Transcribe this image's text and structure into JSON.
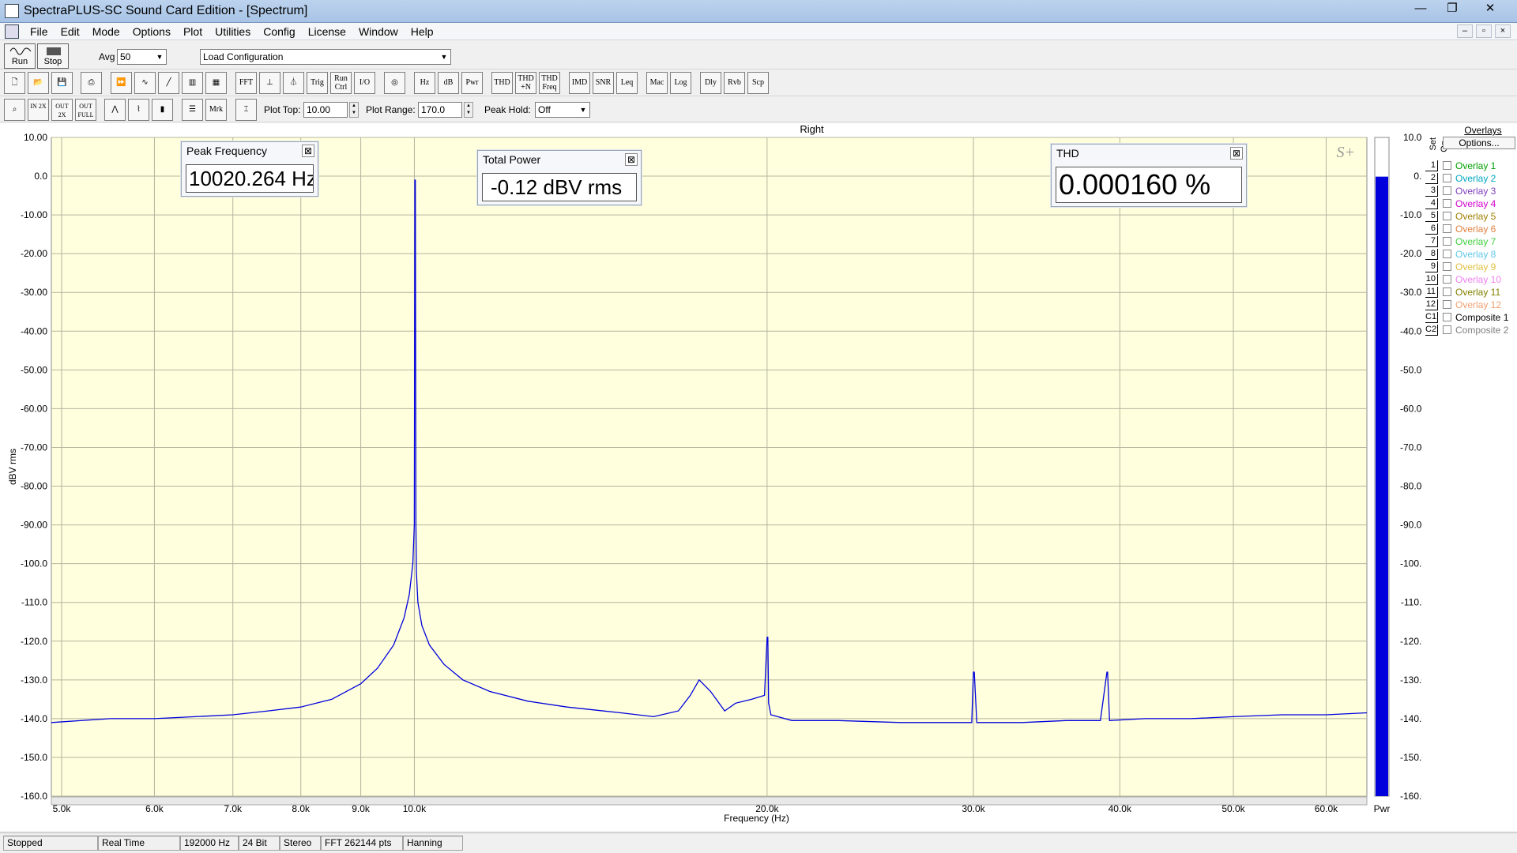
{
  "window": {
    "title": "SpectraPLUS-SC Sound Card Edition - [Spectrum]",
    "buttons": [
      "—",
      "❐",
      "✕"
    ]
  },
  "menu": [
    "File",
    "Edit",
    "Mode",
    "Options",
    "Plot",
    "Utilities",
    "Config",
    "License",
    "Window",
    "Help"
  ],
  "mdi_buttons": [
    "–",
    "▫",
    "×"
  ],
  "toolbar1": {
    "run": "Run",
    "stop": "Stop",
    "avg_label": "Avg",
    "avg_value": "50",
    "config_value": "Load Configuration"
  },
  "toolbar2": [
    "FFT",
    "Trig",
    "Run Ctrl",
    "I/O",
    "Hz",
    "dB",
    "Pwr",
    "THD",
    "THD +N",
    "THD Freq",
    "IMD",
    "SNR",
    "Leq",
    "Mac",
    "Log",
    "Dly",
    "Rvb",
    "Scp"
  ],
  "toolbar3": {
    "zoom_labels": [
      "IN 2X",
      "OUT 2X",
      "OUT FULL"
    ],
    "mrk": "Mrk",
    "plot_top_label": "Plot Top:",
    "plot_top_value": "10.00",
    "plot_range_label": "Plot Range:",
    "plot_range_value": "170.0",
    "peak_hold_label": "Peak Hold:",
    "peak_hold_value": "Off"
  },
  "readouts": {
    "peak_frequency": {
      "title": "Peak Frequency",
      "value": "10020.264 Hz"
    },
    "total_power": {
      "title": "Total Power",
      "value": "-0.12 dBV rms"
    },
    "thd": {
      "title": "THD",
      "value": "0.000160 %"
    }
  },
  "chart_data": {
    "type": "line",
    "title": "Right",
    "xlabel": "Frequency (Hz)",
    "ylabel": "dBV rms",
    "xscale": "log",
    "xlim": [
      4900,
      65000
    ],
    "ylim": [
      -160,
      10
    ],
    "x_ticks": [
      5000,
      6000,
      7000,
      8000,
      9000,
      10000,
      20000,
      30000,
      40000,
      50000,
      60000
    ],
    "x_tick_labels": [
      "5.0k",
      "6.0k",
      "7.0k",
      "8.0k",
      "9.0k",
      "10.0k",
      "20.0k",
      "30.0k",
      "40.0k",
      "50.0k",
      "60.0k"
    ],
    "y_ticks": [
      10,
      0,
      -10,
      -20,
      -30,
      -40,
      -50,
      -60,
      -70,
      -80,
      -90,
      -100,
      -110,
      -120,
      -130,
      -140,
      -150,
      -160
    ],
    "y_tick_labels": [
      "10.00",
      "0.0",
      "-10.00",
      "-20.00",
      "-30.00",
      "-40.00",
      "-50.00",
      "-60.00",
      "-70.00",
      "-80.00",
      "-90.00",
      "-100.0",
      "-110.0",
      "-120.0",
      "-130.0",
      "-140.0",
      "-150.0",
      "-160.0"
    ],
    "grid": true,
    "background": "#ffffdd",
    "series_color": "#0000dd",
    "series": [
      {
        "x": [
          4900,
          5500,
          6000,
          6500,
          7000,
          7500,
          8000,
          8500,
          9000,
          9300,
          9600,
          9800,
          9900,
          9970,
          10000,
          10010,
          10020,
          10030,
          10040,
          10070,
          10150,
          10300,
          10600,
          11000,
          11600,
          12500,
          13500,
          15000,
          16000,
          16800,
          17200,
          17500,
          17900,
          18400,
          18800,
          19400,
          19900,
          20000,
          20030,
          20060,
          20150,
          21000,
          23000,
          26000,
          29900,
          30000,
          30050,
          30200,
          33000,
          36000,
          38500,
          39000,
          39050,
          39200,
          42000,
          46000,
          50000,
          55000,
          60000,
          65000
        ],
        "y": [
          -141,
          -140,
          -140,
          -139.5,
          -139,
          -138,
          -137,
          -135,
          -131,
          -127,
          -121,
          -114,
          -108,
          -100,
          -90,
          -1,
          -1,
          -90,
          -102,
          -110,
          -116,
          -121,
          -126,
          -130,
          -133,
          -135.5,
          -137,
          -138.5,
          -139.5,
          -138,
          -134,
          -130,
          -133,
          -138,
          -136,
          -135,
          -134,
          -119,
          -119,
          -136,
          -139,
          -140.5,
          -140.5,
          -141,
          -141,
          -128,
          -128,
          -141,
          -141,
          -140.5,
          -140.5,
          -128,
          -128,
          -140.5,
          -140,
          -140,
          -139.5,
          -139,
          -139,
          -138.5
        ]
      }
    ],
    "power_bar": {
      "value": -0.12,
      "label": "Pwr",
      "color": "#0000dd"
    }
  },
  "overlays": {
    "header": "Overlays",
    "options_label": "Options...",
    "col_set": "Set",
    "col_on": "On",
    "items": [
      {
        "set": "1",
        "name": "Overlay 1",
        "color": "#00a000"
      },
      {
        "set": "2",
        "name": "Overlay 2",
        "color": "#00a8c0"
      },
      {
        "set": "3",
        "name": "Overlay 3",
        "color": "#8040c0"
      },
      {
        "set": "4",
        "name": "Overlay 4",
        "color": "#d000d0"
      },
      {
        "set": "5",
        "name": "Overlay 5",
        "color": "#a08000"
      },
      {
        "set": "6",
        "name": "Overlay 6",
        "color": "#e08040"
      },
      {
        "set": "7",
        "name": "Overlay 7",
        "color": "#40d040"
      },
      {
        "set": "8",
        "name": "Overlay 8",
        "color": "#60c8e8"
      },
      {
        "set": "9",
        "name": "Overlay 9",
        "color": "#e0c040"
      },
      {
        "set": "10",
        "name": "Overlay 10",
        "color": "#f080f0"
      },
      {
        "set": "11",
        "name": "Overlay 11",
        "color": "#808000"
      },
      {
        "set": "12",
        "name": "Overlay 12",
        "color": "#f0a070"
      },
      {
        "set": "C1",
        "name": "Composite 1",
        "color": "#000000"
      },
      {
        "set": "C2",
        "name": "Composite 2",
        "color": "#808080"
      }
    ]
  },
  "status": [
    "Stopped",
    "Real Time",
    "192000 Hz",
    "24 Bit",
    "Stereo",
    "FFT 262144 pts",
    "Hanning"
  ]
}
